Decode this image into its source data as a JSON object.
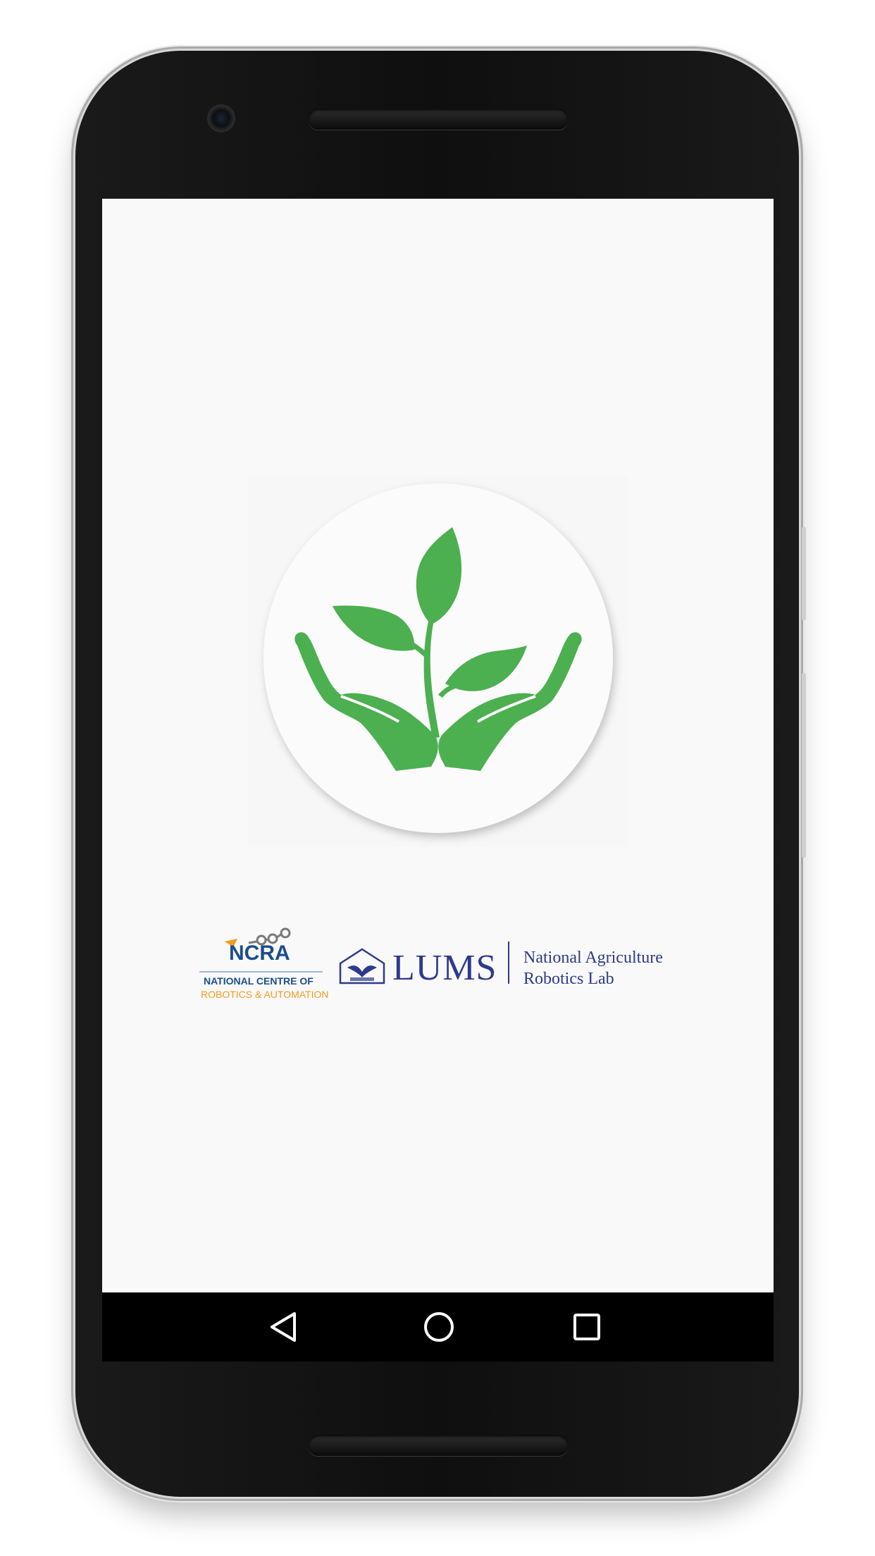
{
  "status_bar": {
    "left_text": "",
    "right_text": ""
  },
  "app": {
    "icon_name": "plant-in-hands-icon",
    "icon_color": "#4caf50"
  },
  "partners": {
    "ncra": {
      "name": "NCRA",
      "line1": "NATIONAL CENTRE OF",
      "line2": "ROBOTICS & AUTOMATION",
      "primary_color": "#1b4d8c",
      "accent_color": "#f39a1e"
    },
    "lums": {
      "name": "LUMS",
      "lab_line1": "National Agriculture",
      "lab_line2": "Robotics Lab",
      "color": "#2d3a8c"
    }
  },
  "nav_bar": {
    "back_icon": "back-triangle-icon",
    "home_icon": "home-circle-icon",
    "recents_icon": "recents-square-icon"
  }
}
